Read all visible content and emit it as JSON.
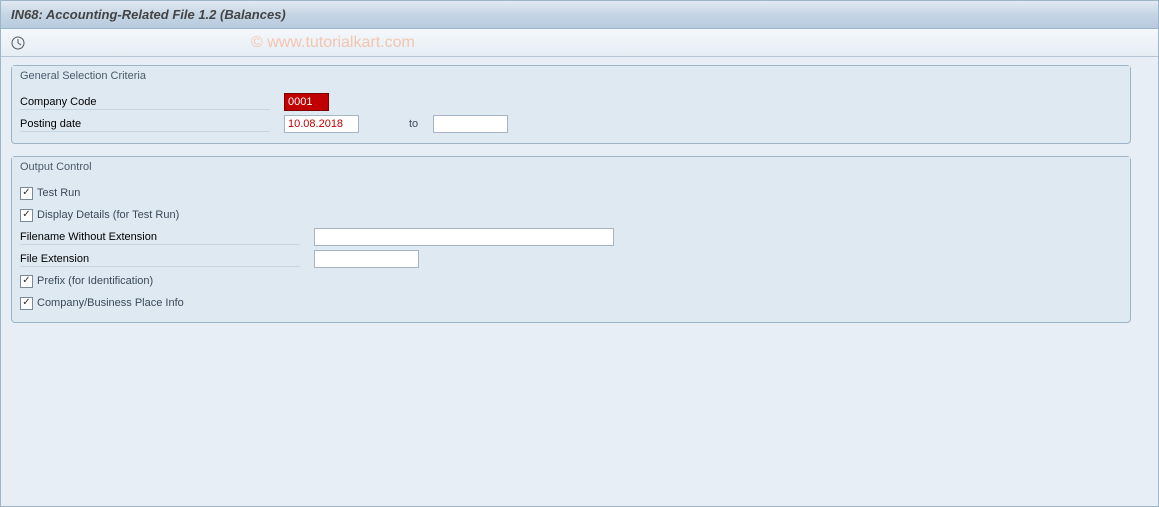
{
  "title": "IN68: Accounting-Related File 1.2 (Balances)",
  "watermark": "© www.tutorialkart.com",
  "group1": {
    "title": "General Selection Criteria",
    "company_code_label": "Company Code",
    "company_code_value": "0001",
    "posting_date_label": "Posting date",
    "posting_date_from": "10.08.2018",
    "posting_date_to_label": "to",
    "posting_date_to": ""
  },
  "group2": {
    "title": "Output Control",
    "test_run_label": "Test Run",
    "display_details_label": "Display Details (for Test Run)",
    "filename_label": "Filename Without Extension",
    "filename_value": "",
    "file_ext_label": "File Extension",
    "file_ext_value": "",
    "prefix_label": "Prefix (for Identification)",
    "company_info_label": "Company/Business Place Info"
  },
  "checkmark": "✓"
}
